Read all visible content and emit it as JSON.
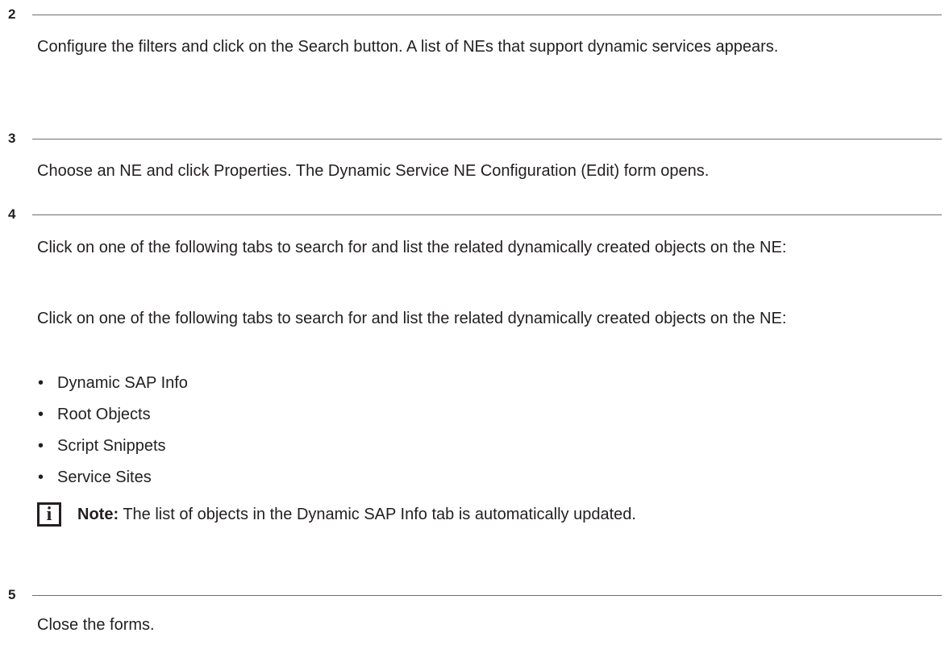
{
  "steps": [
    {
      "number": "2",
      "text": "Configure the filters and click on the Search button. A list of NEs that support dynamic services appears."
    },
    {
      "number": "3",
      "text": "Choose an NE and click Properties. The Dynamic Service NE Configuration (Edit) form opens."
    },
    {
      "number": "4",
      "text": "Click on one of the following tabs to search for and list the related dynamically created objects on the NE:",
      "text_repeat": "Click on one of the following tabs to search for and list the related dynamically created objects on the NE:",
      "bullet_symbol": "•",
      "bullets": [
        "Dynamic SAP Info",
        "Root Objects",
        "Script Snippets",
        "Service Sites"
      ],
      "note": {
        "icon": "info-icon",
        "icon_glyph": "i",
        "label": "Note:",
        "text": "The list of objects in the Dynamic SAP Info tab is automatically updated."
      }
    },
    {
      "number": "5",
      "text": "Close the forms."
    }
  ]
}
